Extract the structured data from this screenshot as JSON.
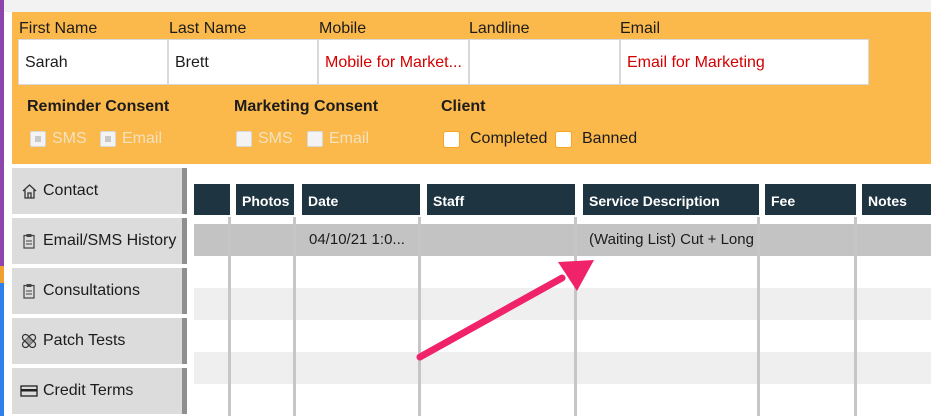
{
  "client": {
    "labels": {
      "first_name": "First Name",
      "last_name": "Last Name",
      "mobile": "Mobile",
      "landline": "Landline",
      "email": "Email"
    },
    "values": {
      "first_name": "Sarah",
      "last_name": "Brett",
      "mobile": "Mobile for Market...",
      "landline": "",
      "email": "Email for Marketing"
    }
  },
  "consent": {
    "reminder": {
      "title": "Reminder Consent",
      "sms": "SMS",
      "email": "Email",
      "sms_checked": true,
      "email_checked": true
    },
    "marketing": {
      "title": "Marketing Consent",
      "sms": "SMS",
      "email": "Email",
      "sms_checked": false,
      "email_checked": false
    },
    "client": {
      "title": "Client",
      "completed": "Completed",
      "banned": "Banned"
    }
  },
  "sidebar": {
    "items": [
      {
        "label": "Contact",
        "icon": "home-icon"
      },
      {
        "label": "Email/SMS History",
        "icon": "clipboard-icon"
      },
      {
        "label": "Consultations",
        "icon": "clipboard-icon"
      },
      {
        "label": "Patch Tests",
        "icon": "bandage-icon"
      },
      {
        "label": "Credit Terms",
        "icon": "card-icon"
      }
    ]
  },
  "table": {
    "headers": [
      "",
      "Photos",
      "Date",
      "Staff",
      "Service Description",
      "Fee",
      "Notes"
    ],
    "rows": [
      {
        "photos": "",
        "date": "04/10/21 1:0...",
        "staff": "",
        "service": "(Waiting List) Cut + Long",
        "fee": "",
        "notes": ""
      }
    ]
  },
  "colors": {
    "panel": "#fbb84b",
    "header": "#1e3441",
    "marketing_text": "#d40000",
    "arrow": "#f0226a"
  }
}
